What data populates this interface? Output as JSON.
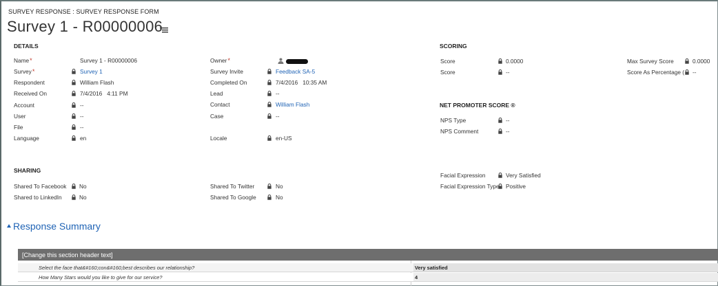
{
  "header": {
    "breadcrumb": "SURVEY RESPONSE : SURVEY RESPONSE FORM",
    "title": "Survey 1 - R00000006"
  },
  "sections": {
    "details": "DETAILS",
    "scoring": "SCORING",
    "nps": "NET PROMOTER SCORE ®",
    "sharing": "SHARING"
  },
  "details": {
    "name_label": "Name",
    "name_value": "Survey 1 - R00000006",
    "survey_label": "Survey",
    "survey_value": "Survey 1",
    "respondent_label": "Respondent",
    "respondent_value": "William Flash",
    "received_label": "Received On",
    "received_value": "7/4/2016   4:11 PM",
    "account_label": "Account",
    "account_value": "--",
    "user_label": "User",
    "user_value": "--",
    "file_label": "File",
    "file_value": "--",
    "language_label": "Language",
    "language_value": "en",
    "owner_label": "Owner",
    "invite_label": "Survey Invite",
    "invite_value": "Feedback SA-5",
    "completed_label": "Completed On",
    "completed_value": "7/4/2016   10:35 AM",
    "lead_label": "Lead",
    "lead_value": "--",
    "contact_label": "Contact",
    "contact_value": "William Flash",
    "case_label": "Case",
    "case_value": "--",
    "locale_label": "Locale",
    "locale_value": "en-US"
  },
  "scoring": {
    "score1_label": "Score",
    "score1_value": "0.0000",
    "score2_label": "Score",
    "score2_value": "--",
    "max_label": "Max Survey Score",
    "max_value": "0.0000",
    "pct_label": "Score As Percentage (",
    "pct_value": "--"
  },
  "nps": {
    "type_label": "NPS Type",
    "type_value": "--",
    "comment_label": "NPS Comment",
    "comment_value": "--"
  },
  "facial": {
    "expr_label": "Facial Expression",
    "expr_value": "Very Satisfied",
    "type_label": "Facial Expression Type",
    "type_value": "Positive"
  },
  "sharing": {
    "facebook_label": "Shared To Facebook",
    "facebook_value": "No",
    "linkedin_label": "Shared to LinkedIn",
    "linkedin_value": "No",
    "twitter_label": "Shared To Twitter",
    "twitter_value": "No",
    "google_label": "Shared To Google",
    "google_value": "No"
  },
  "response_summary": {
    "title": "Response Summary",
    "grid_header": "[Change this section header text]",
    "rows": [
      {
        "question": "Select the face that&#160;con&#160;best describes our relationship?",
        "answer": "Very satisfied"
      },
      {
        "question": "How Many Stars would you like to give for our service?",
        "answer": "4"
      }
    ]
  },
  "colors": {
    "link": "#1f63b5",
    "required": "#c0392b",
    "grid_header": "#6e6e6e"
  },
  "icons": {
    "lock": "lock-icon",
    "menu": "menu-icon",
    "owner": "user-icon"
  }
}
